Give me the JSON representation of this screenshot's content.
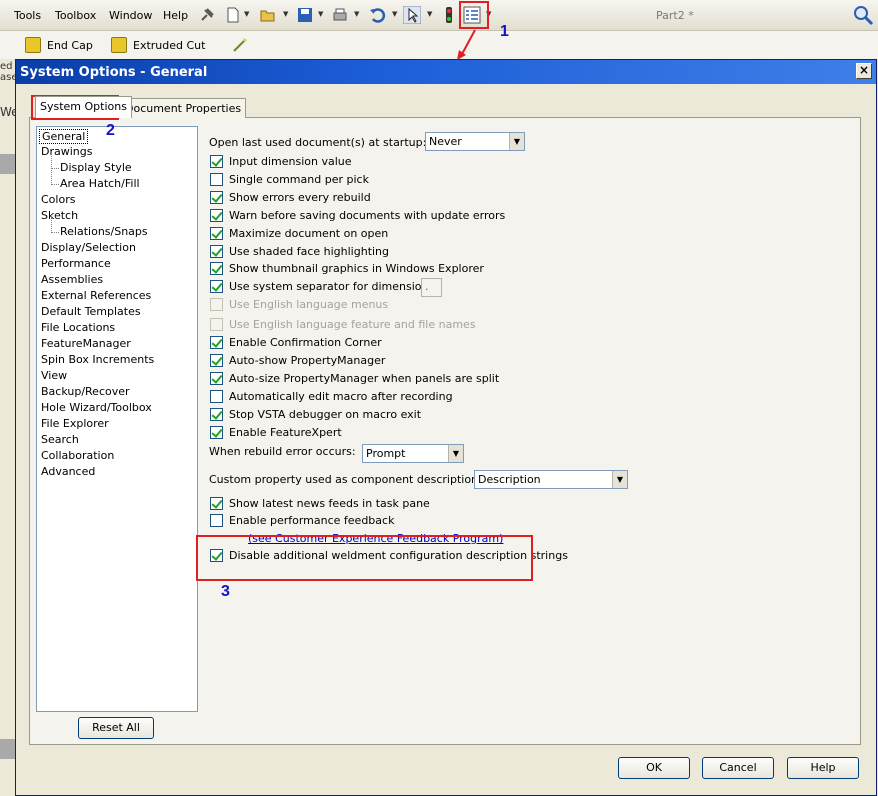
{
  "menubar": {
    "items": [
      "Tools",
      "Toolbox",
      "Window",
      "Help"
    ],
    "document_title": "Part2 *"
  },
  "featurebar": {
    "items": [
      "End Cap",
      "Extruded Cut"
    ]
  },
  "left_strip": {
    "fragments": [
      "ed",
      "ase",
      "We"
    ]
  },
  "dialog": {
    "title": "System Options - General",
    "close_label": "×",
    "tabs": [
      "System Options",
      "Document Properties"
    ],
    "tree": [
      {
        "label": "General",
        "level": 0
      },
      {
        "label": "Drawings",
        "level": 0
      },
      {
        "label": "Display Style",
        "level": 1
      },
      {
        "label": "Area Hatch/Fill",
        "level": 1
      },
      {
        "label": "Colors",
        "level": 0
      },
      {
        "label": "Sketch",
        "level": 0
      },
      {
        "label": "Relations/Snaps",
        "level": 1
      },
      {
        "label": "Display/Selection",
        "level": 0
      },
      {
        "label": "Performance",
        "level": 0
      },
      {
        "label": "Assemblies",
        "level": 0
      },
      {
        "label": "External References",
        "level": 0
      },
      {
        "label": "Default Templates",
        "level": 0
      },
      {
        "label": "File Locations",
        "level": 0
      },
      {
        "label": "FeatureManager",
        "level": 0
      },
      {
        "label": "Spin Box Increments",
        "level": 0
      },
      {
        "label": "View",
        "level": 0
      },
      {
        "label": "Backup/Recover",
        "level": 0
      },
      {
        "label": "Hole Wizard/Toolbox",
        "level": 0
      },
      {
        "label": "File Explorer",
        "level": 0
      },
      {
        "label": "Search",
        "level": 0
      },
      {
        "label": "Collaboration",
        "level": 0
      },
      {
        "label": "Advanced",
        "level": 0
      }
    ],
    "reset_all": "Reset All",
    "open_last_label": "Open last used document(s) at startup:",
    "open_last_value": "Never",
    "options_a": [
      {
        "label": "Input dimension value",
        "checked": true,
        "enabled": true
      },
      {
        "label": "Single command per pick",
        "checked": false,
        "enabled": true
      },
      {
        "label": "Show errors every rebuild",
        "checked": true,
        "enabled": true
      },
      {
        "label": "Warn before saving documents with update errors",
        "checked": true,
        "enabled": true
      },
      {
        "label": "Maximize document on open",
        "checked": true,
        "enabled": true
      },
      {
        "label": "Use shaded face highlighting",
        "checked": true,
        "enabled": true
      },
      {
        "label": "Show thumbnail graphics in Windows Explorer",
        "checked": true,
        "enabled": true
      },
      {
        "label": "Use system separator for dimensions",
        "checked": true,
        "enabled": true
      },
      {
        "label": "Use English language menus",
        "checked": false,
        "enabled": false
      },
      {
        "label": "Use English language feature and file names",
        "checked": false,
        "enabled": false
      },
      {
        "label": "Enable Confirmation Corner",
        "checked": true,
        "enabled": true
      },
      {
        "label": "Auto-show PropertyManager",
        "checked": true,
        "enabled": true
      },
      {
        "label": "Auto-size PropertyManager when panels are split",
        "checked": true,
        "enabled": true
      },
      {
        "label": "Automatically edit macro after recording",
        "checked": false,
        "enabled": true
      },
      {
        "label": "Stop VSTA debugger on macro exit",
        "checked": true,
        "enabled": true
      },
      {
        "label": "Enable FeatureXpert",
        "checked": true,
        "enabled": true
      }
    ],
    "separator_value": ".",
    "rebuild_error_label": "When rebuild error occurs:",
    "rebuild_error_value": "Prompt",
    "custom_property_label": "Custom property used as component description:",
    "custom_property_value": "Description",
    "options_b": [
      {
        "label": "Show latest news feeds in task pane",
        "checked": true,
        "enabled": true
      },
      {
        "label": "Enable performance feedback",
        "checked": false,
        "enabled": true
      }
    ],
    "feedback_link": "(see Customer Experience Feedback Program)",
    "weldment_option": {
      "label": "Disable additional weldment configuration description strings",
      "checked": true
    },
    "buttons": {
      "ok": "OK",
      "cancel": "Cancel",
      "help": "Help"
    }
  },
  "annotations": {
    "marker_1": "1",
    "marker_2": "2",
    "marker_3": "3"
  },
  "colors": {
    "annotation_red": "#e02020",
    "marker_blue": "#1212c8",
    "title_blue": "#0a3ea8"
  }
}
